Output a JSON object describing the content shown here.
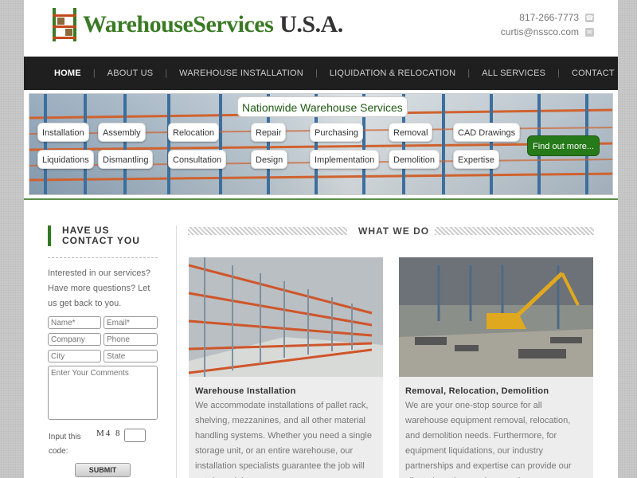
{
  "header": {
    "logo_text_main": "WarehouseServices",
    "logo_text_suffix": "U.S.A.",
    "phone": "817-266-7773",
    "email": "curtis@nssco.com"
  },
  "nav": {
    "items": [
      "HOME",
      "ABOUT US",
      "WAREHOUSE INSTALLATION",
      "LIQUIDATION & RELOCATION",
      "ALL SERVICES",
      "CONTACT"
    ],
    "active_index": 0
  },
  "banner": {
    "title": "Nationwide Warehouse Services",
    "row1": [
      "Installation",
      "Assembly",
      "Relocation",
      "Repair",
      "Purchasing",
      "Removal",
      "CAD Drawings"
    ],
    "row2": [
      "Liquidations",
      "Dismantling",
      "Consultation",
      "Design",
      "Implementation",
      "Demolition",
      "Expertise"
    ],
    "cta": "Find out more..."
  },
  "sidebar": {
    "heading": "HAVE US CONTACT YOU",
    "intro": "Interested in our services? Have more questions? Let us get back to you.",
    "fields": {
      "name": "Name*",
      "email": "Email*",
      "company": "Company",
      "phone": "Phone",
      "city": "City",
      "state": "State",
      "comments": "Enter Your Comments"
    },
    "captcha_label": "Input this code:",
    "captcha_code": "M4 8 S",
    "submit": "SUBMIT"
  },
  "main": {
    "section_title": "WHAT WE DO",
    "cards": [
      {
        "title": "Warehouse Installation",
        "body": "We accommodate installations of pallet rack, shelving, mezzanines, and all other material handling systems. Whether you need a single storage unit, or an entire warehouse, our installation specialists guarantee the job will get done right."
      },
      {
        "title": "Removal, Relocation, Demolition",
        "body": "We are your one-stop source for all warehouse equipment removal, relocation, and demolition needs. Furthermore, for equipment liquidations, our industry partnerships and expertise can provide our clients lucrative purchase options."
      }
    ]
  },
  "colors": {
    "brand_green": "#3a7a25",
    "nav_bg": "#1f1f1f",
    "cta_green": "#267a19"
  },
  "icons": {
    "phone": "phone-icon",
    "email": "email-icon"
  }
}
